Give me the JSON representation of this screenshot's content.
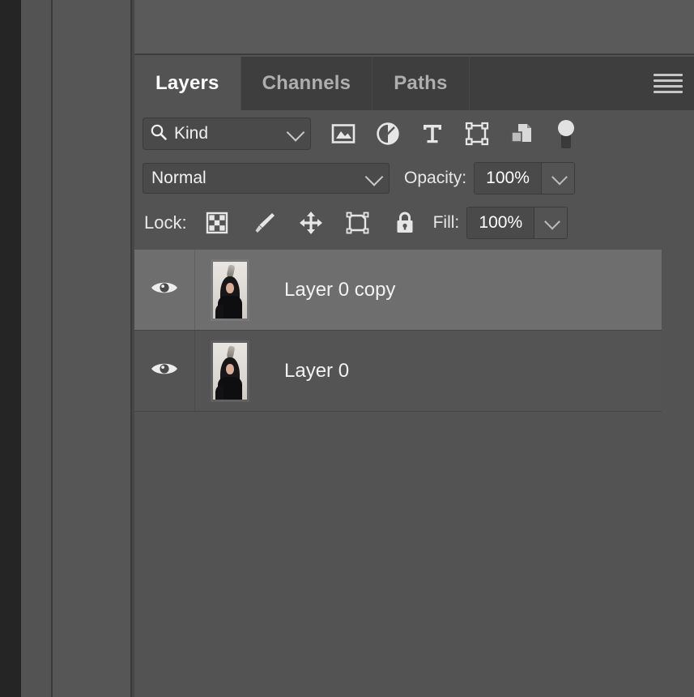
{
  "app": {
    "panel_title": "Layers"
  },
  "tabs": [
    {
      "label": "Layers",
      "active": true
    },
    {
      "label": "Channels",
      "active": false
    },
    {
      "label": "Paths",
      "active": false
    }
  ],
  "panel_menu": {
    "icon": "hamburger-menu-icon"
  },
  "filter": {
    "search_icon": "search-icon",
    "kind_label": "Kind",
    "dropdown_icon": "chevron-down-icon",
    "type_filters": [
      {
        "name": "filter-pixel-layers",
        "icon": "image-icon"
      },
      {
        "name": "filter-adjustment-layers",
        "icon": "adjustment-circle-icon"
      },
      {
        "name": "filter-type-layers",
        "icon": "text-t-icon"
      },
      {
        "name": "filter-shape-layers",
        "icon": "shape-bounding-box-icon"
      },
      {
        "name": "filter-smart-objects",
        "icon": "smart-object-icon"
      }
    ],
    "toggle": {
      "name": "filter-enable-toggle",
      "icon": "toggle-switch-icon"
    }
  },
  "blend": {
    "mode": "Normal",
    "mode_dropdown_icon": "chevron-down-icon",
    "opacity_label": "Opacity:",
    "opacity_value": "100%",
    "opacity_dropdown_icon": "chevron-down-icon"
  },
  "lock": {
    "label": "Lock:",
    "buttons": [
      {
        "name": "lock-transparent-pixels",
        "icon": "checkerboard-icon"
      },
      {
        "name": "lock-image-pixels",
        "icon": "brush-icon"
      },
      {
        "name": "lock-position",
        "icon": "move-arrows-icon"
      },
      {
        "name": "lock-artboard-nesting",
        "icon": "artboard-icon"
      },
      {
        "name": "lock-all",
        "icon": "padlock-icon"
      }
    ],
    "fill_label": "Fill:",
    "fill_value": "100%",
    "fill_dropdown_icon": "chevron-down-icon"
  },
  "layers": [
    {
      "name": "Layer 0 copy",
      "visible": true,
      "selected": true,
      "visibility_icon": "eye-icon",
      "thumbnail": "portrait-thumbnail"
    },
    {
      "name": "Layer 0",
      "visible": true,
      "selected": false,
      "visibility_icon": "eye-icon",
      "thumbnail": "portrait-thumbnail"
    }
  ],
  "colors": {
    "panel_background": "#535353",
    "tabbar_background": "#3e3e3e",
    "active_tab_background": "#535353",
    "selected_row": "#6e6e6e",
    "row": "#545454",
    "field_background": "#4a4a4a",
    "text_primary": "#f2f2f2",
    "text_muted": "#aeaeae"
  }
}
